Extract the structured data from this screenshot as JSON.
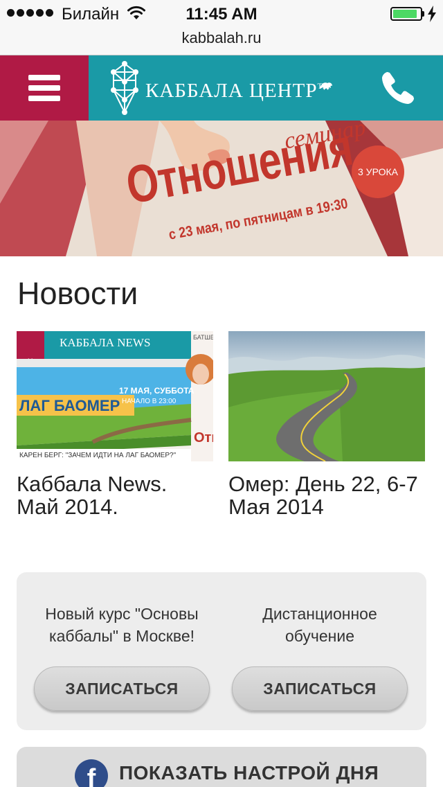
{
  "status_bar": {
    "carrier": "Билайн",
    "time": "11:45 AM",
    "battery_level": 0.9,
    "battery_color": "#4cd964"
  },
  "browser": {
    "url": "kabbalah.ru"
  },
  "header": {
    "menu_icon": "hamburger-menu-icon",
    "logo_text": "КАББАЛА ЦЕНТР",
    "logo_trademark": "TM",
    "phone_icon": "phone-icon",
    "colors": {
      "menu_bg": "#b01a45",
      "header_bg": "#1a9aa6"
    }
  },
  "banner": {
    "seminar": "семинар",
    "title": "Отношения",
    "badge": "3 УРОКА",
    "subtitle": "с 23 мая, по пятницам в 19:30"
  },
  "news": {
    "heading": "Новости",
    "items": [
      {
        "caption": "Каббала News. Май 2014.",
        "thumb": {
          "masthead": "КАББАЛА NEWS",
          "city": "Москва",
          "headline": "ЛАГ БАОМЕР",
          "date_line": "17 МАЯ, СУББОТА",
          "time_line": "НАЧАЛО В 23:00",
          "quote": "КАРЕН БЕРГ: \"ЗАЧЕМ ИДТИ НА ЛАГ БАОМЕР?\"",
          "side_label": "БАТШЕ",
          "side_word": "Отн"
        }
      },
      {
        "caption": "Омер: День 22, 6-7 Мая 2014"
      }
    ]
  },
  "cta": {
    "items": [
      {
        "text": "Новый курс \"Основы каббалы\" в Москве!",
        "button": "ЗАПИСАТЬСЯ"
      },
      {
        "text": "Дистанционное обучение",
        "button": "ЗАПИСАТЬСЯ"
      }
    ]
  },
  "mood_button": {
    "icon": "facebook-icon",
    "icon_glyph": "f",
    "label": "ПОКАЗАТЬ НАСТРОЙ ДНЯ"
  }
}
